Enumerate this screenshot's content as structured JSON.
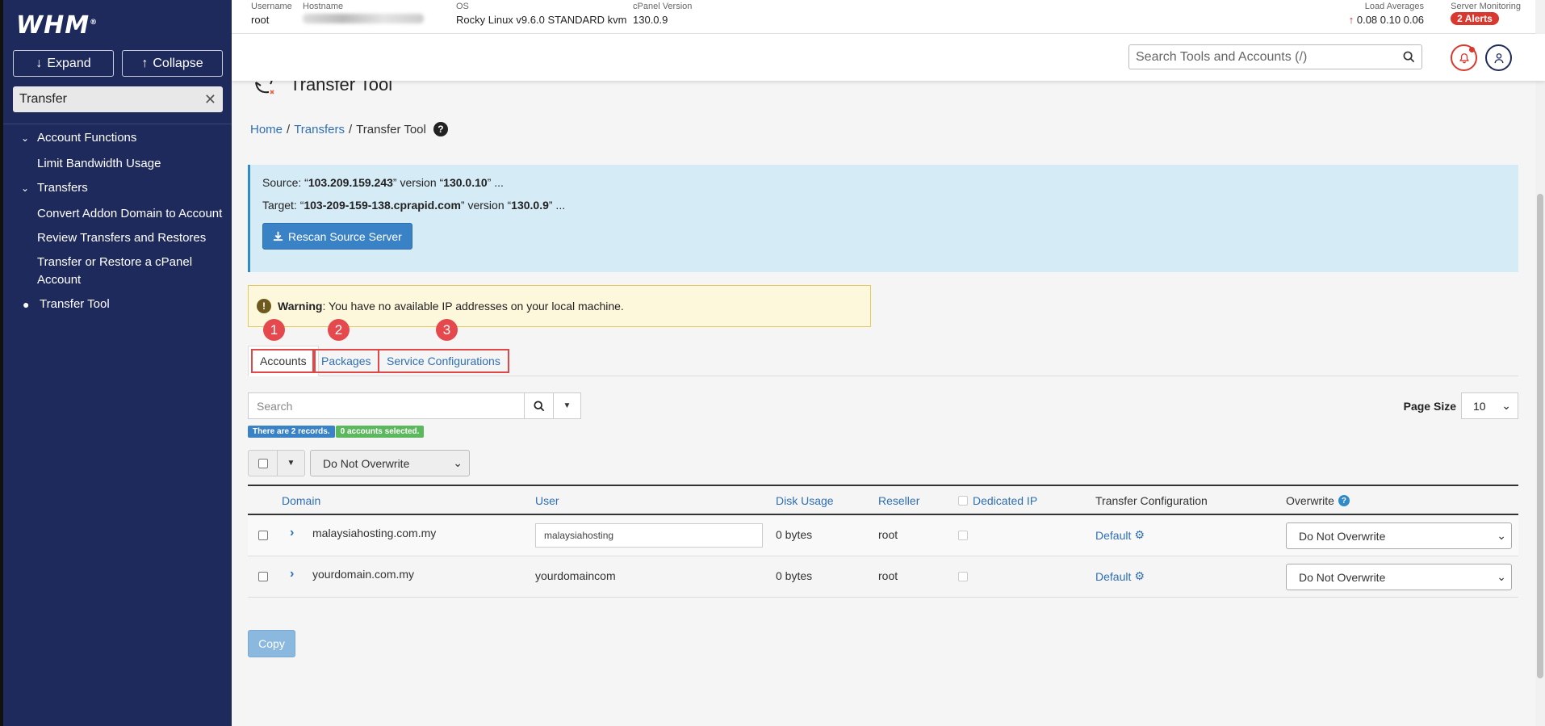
{
  "sidebar": {
    "logo": "WHM",
    "logo_mark": "®",
    "expand_label": "Expand",
    "collapse_label": "Collapse",
    "search_value": "Transfer",
    "groups": [
      {
        "label": "Account Functions"
      },
      {
        "label": "Limit Bandwidth Usage"
      },
      {
        "label": "Transfers"
      },
      {
        "label": "Convert Addon Domain to Account"
      },
      {
        "label": "Review Transfers and Restores"
      },
      {
        "label": "Transfer or Restore a cPanel Account"
      },
      {
        "label": "Transfer Tool"
      }
    ]
  },
  "topbar": {
    "username_label": "Username",
    "username": "root",
    "hostname_label": "Hostname",
    "os_label": "OS",
    "os": "Rocky Linux v9.6.0 STANDARD kvm",
    "cpanel_label": "cPanel Version",
    "cpanel": "130.0.9",
    "load_label": "Load Averages",
    "load_values": "0.08  0.10  0.06",
    "monitoring_label": "Server Monitoring",
    "alerts": "2 Alerts"
  },
  "header": {
    "search_placeholder": "Search Tools and Accounts (/)"
  },
  "page": {
    "title": "Transfer Tool",
    "breadcrumb_home": "Home",
    "breadcrumb_transfers": "Transfers",
    "breadcrumb_current": "Transfer Tool"
  },
  "info": {
    "source_prefix": "Source: “",
    "source_host": "103.209.159.243",
    "source_mid": "” version “",
    "source_version": "130.0.10",
    "source_suffix": "” ...",
    "target_prefix": "Target: “",
    "target_host": "103-209-159-138.cprapid.com",
    "target_mid": "” version “",
    "target_version": "130.0.9",
    "target_suffix": "” ...",
    "rescan_label": "Rescan Source Server"
  },
  "warning": {
    "title": "Warning",
    "text": ": You have no available IP addresses on your local machine."
  },
  "tabs": [
    {
      "label": "Accounts",
      "step": "1"
    },
    {
      "label": "Packages",
      "step": "2"
    },
    {
      "label": "Service Configurations",
      "step": "3"
    }
  ],
  "accounts": {
    "search_placeholder": "Search",
    "page_size_label": "Page Size",
    "page_size": "10",
    "records_badge": "There are 2 records.",
    "selected_badge": "0 accounts selected.",
    "bulk_overwrite": "Do Not Overwrite",
    "columns": {
      "domain": "Domain",
      "user": "User",
      "disk": "Disk Usage",
      "reseller": "Reseller",
      "dedicated": "Dedicated IP",
      "config": "Transfer Configuration",
      "overwrite": "Overwrite"
    },
    "rows": [
      {
        "domain": "malaysiahosting.com.my",
        "user": "malaysiahosting",
        "disk": "0 bytes",
        "reseller": "root",
        "config": "Default",
        "overwrite": "Do Not Overwrite"
      },
      {
        "domain": "yourdomain.com.my",
        "user": "yourdomaincom",
        "disk": "0 bytes",
        "reseller": "root",
        "config": "Default",
        "overwrite": "Do Not Overwrite"
      }
    ],
    "copy_label": "Copy"
  }
}
